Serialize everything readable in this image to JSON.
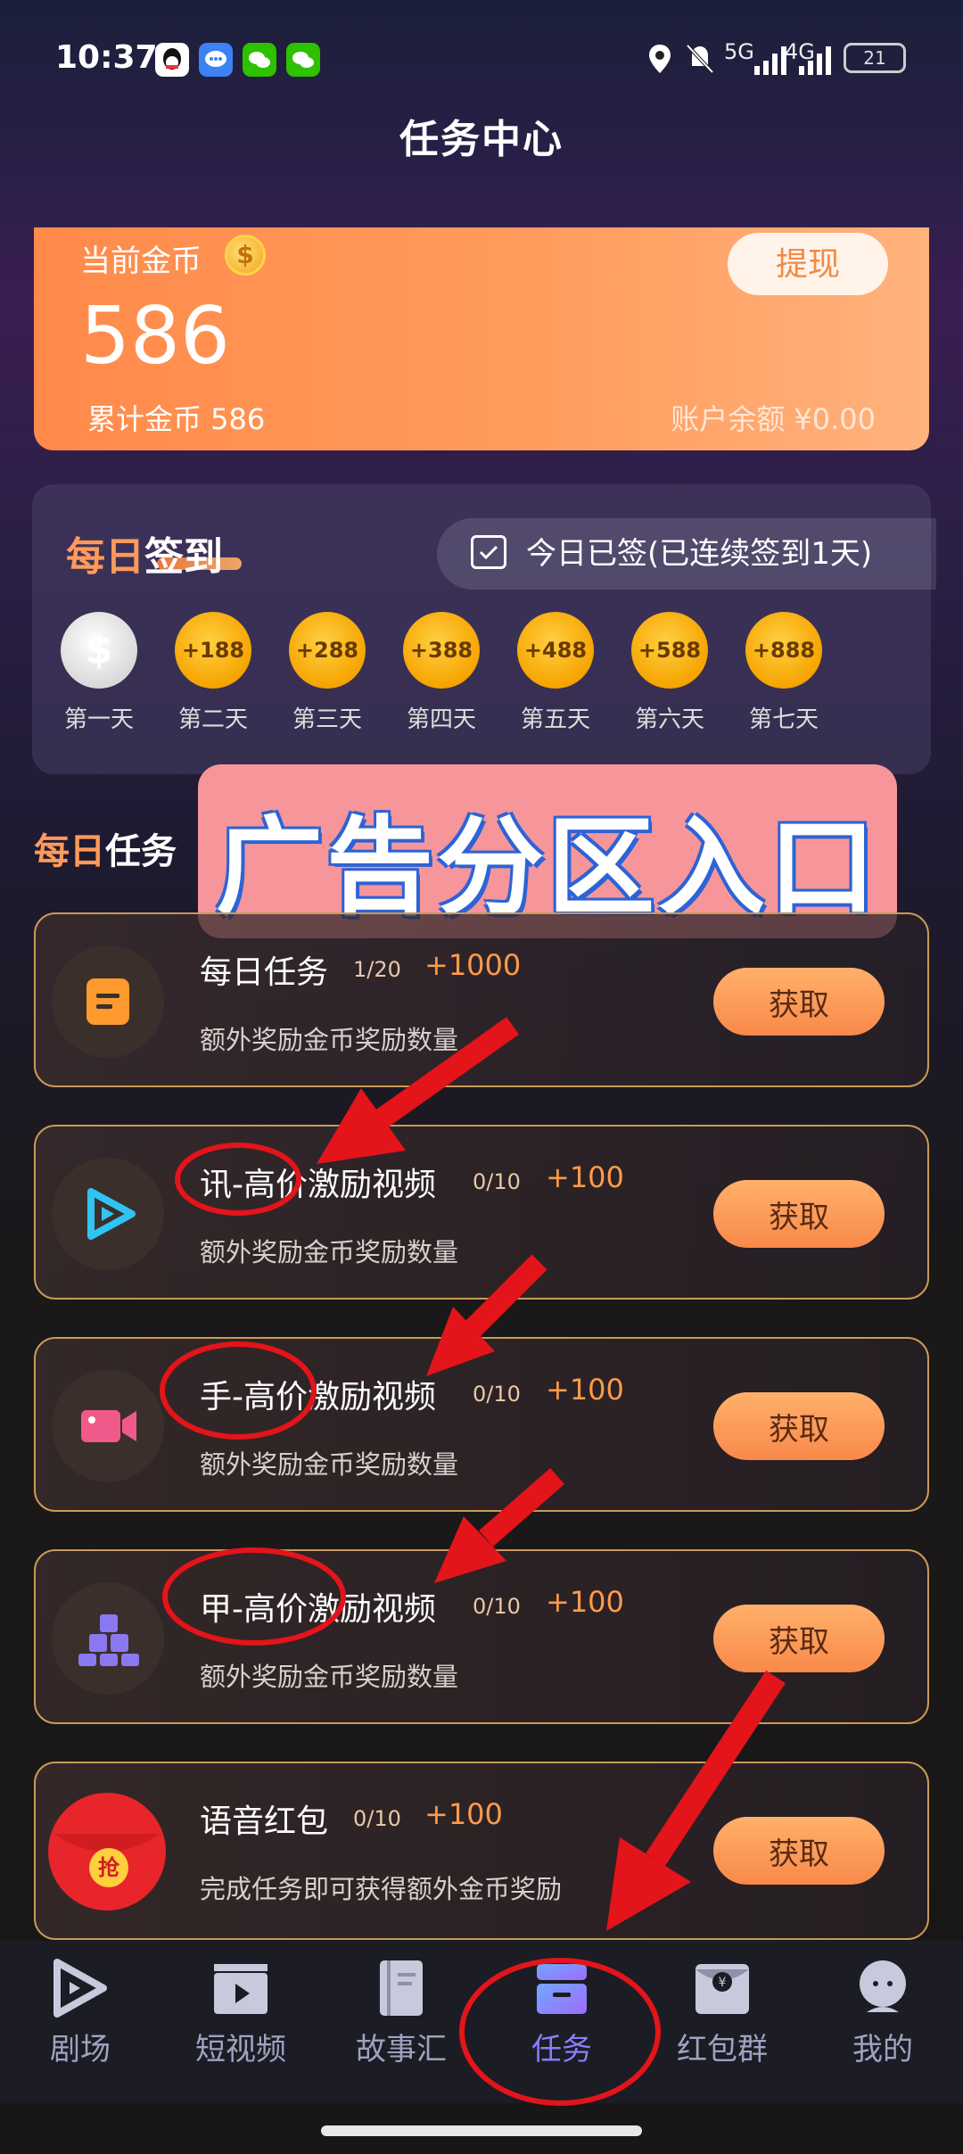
{
  "status_bar": {
    "time": "10:37",
    "net1": "5G",
    "net2": "4G",
    "battery": "21"
  },
  "header": {
    "title": "任务中心"
  },
  "balance": {
    "label": "当前金币",
    "amount": "586",
    "total_label": "累计金币  586",
    "account_balance": "账户余额 ¥0.00",
    "withdraw": "提现",
    "coin_symbol": "$"
  },
  "signin": {
    "title_hl": "每日",
    "title": "签到",
    "status": "今日已签(已连续签到1天)",
    "days": [
      {
        "reward": "$",
        "label": "第一天",
        "done": true
      },
      {
        "reward": "+188",
        "label": "第二天"
      },
      {
        "reward": "+288",
        "label": "第三天"
      },
      {
        "reward": "+388",
        "label": "第四天"
      },
      {
        "reward": "+488",
        "label": "第五天"
      },
      {
        "reward": "+588",
        "label": "第六天"
      },
      {
        "reward": "+888",
        "label": "第七天"
      }
    ]
  },
  "ad_banner": "广告分区入口",
  "daily_tasks": {
    "title_hl": "每日",
    "title": "任务",
    "tasks": [
      {
        "name": "每日任务",
        "progress": "1/20",
        "reward": "+1000",
        "desc": "额外奖励金币奖励数量",
        "button": "获取",
        "icon": "document-icon",
        "color": "#ff9a2e"
      },
      {
        "name": "讯-高价激励视频",
        "progress": "0/10",
        "reward": "+100",
        "desc": "额外奖励金币奖励数量",
        "button": "获取",
        "icon": "play-icon",
        "color": "#2ec5f2"
      },
      {
        "name": "手-高价激励视频",
        "progress": "0/10",
        "reward": "+100",
        "desc": "额外奖励金币奖励数量",
        "button": "获取",
        "icon": "video-camera-icon",
        "color": "#f05a8a"
      },
      {
        "name": "甲-高价激励视频",
        "progress": "0/10",
        "reward": "+100",
        "desc": "额外奖励金币奖励数量",
        "button": "获取",
        "icon": "cubes-icon",
        "color": "#8a78f0"
      },
      {
        "name": "语音红包",
        "progress": "0/10",
        "reward": "+100",
        "desc": "完成任务即可获得额外金币奖励",
        "button": "获取",
        "icon": "red-envelope-icon",
        "color": "#e8252a",
        "envelope_char": "抢"
      }
    ]
  },
  "nav": {
    "items": [
      {
        "label": "剧场",
        "icon": "theater-play-icon"
      },
      {
        "label": "短视频",
        "icon": "clapperboard-icon"
      },
      {
        "label": "故事汇",
        "icon": "book-icon"
      },
      {
        "label": "任务",
        "icon": "task-icon",
        "active": true
      },
      {
        "label": "红包群",
        "icon": "red-packet-icon"
      },
      {
        "label": "我的",
        "icon": "profile-icon"
      }
    ]
  }
}
